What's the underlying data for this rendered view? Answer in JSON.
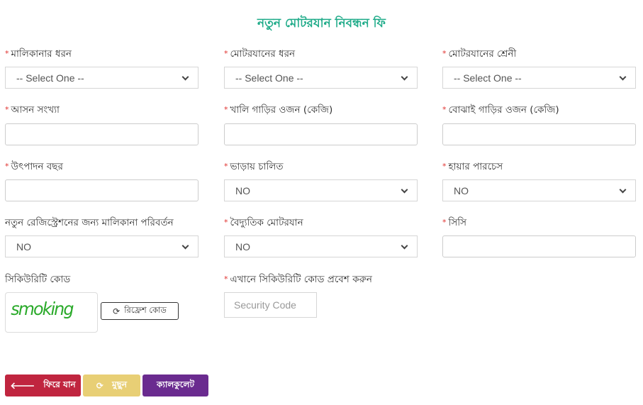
{
  "page": {
    "title": "নতুন মোটরযান নিবন্ধন ফি",
    "title_color": "#1fab89"
  },
  "fields": {
    "ownership_type": {
      "label": "মালিকানার ধরন",
      "required": true,
      "type": "select",
      "value": "-- Select One --"
    },
    "vehicle_type": {
      "label": "মোটরযানের ধরন",
      "required": true,
      "type": "select",
      "value": "-- Select One --"
    },
    "vehicle_class": {
      "label": "মোটরযানের শ্রেনী",
      "required": true,
      "type": "select",
      "value": "-- Select One --"
    },
    "seat_count": {
      "label": "আসন সংখ্যা",
      "required": true,
      "type": "text",
      "value": ""
    },
    "unladen_weight": {
      "label": "খালি গাড়ির ওজন (কেজি)",
      "required": true,
      "type": "text",
      "value": ""
    },
    "laden_weight": {
      "label": "বোঝাই গাড়ির ওজন (কেজি)",
      "required": true,
      "type": "text",
      "value": ""
    },
    "manufacture_year": {
      "label": "উৎপাদন বছর",
      "required": true,
      "type": "text",
      "value": ""
    },
    "hired": {
      "label": "ভাড়ায় চালিত",
      "required": true,
      "type": "select",
      "value": "NO"
    },
    "hire_purchase": {
      "label": "হায়ার পারচেস",
      "required": true,
      "type": "select",
      "value": "NO"
    },
    "ownership_transfer": {
      "label": "নতুন রেজিস্ট্রেশনের জন্য মালিকানা পরিবর্তন",
      "required": false,
      "type": "select",
      "value": "NO"
    },
    "electric_vehicle": {
      "label": "বৈদ্যুতিক মোটরযান",
      "required": true,
      "type": "select",
      "value": "NO"
    },
    "cc": {
      "label": "সিসি",
      "required": true,
      "type": "text",
      "value": ""
    }
  },
  "security": {
    "label": "সিকিউরিটি কোড",
    "captcha_text": "smoking",
    "refresh_label": "রিফ্রেশ কোড",
    "input_label": "এখানে সিকিউরিটি কোড প্রবেশ করুন",
    "input_placeholder": "Security Code",
    "input_value": ""
  },
  "buttons": {
    "back": {
      "label": "ফিরে যান",
      "icon": "arrow-left-icon",
      "color": "#c0253f"
    },
    "clear": {
      "label": "মুছুন",
      "icon": "refresh-icon",
      "color": "#e8cf75"
    },
    "calculate": {
      "label": "ক্যালকুলেট",
      "color": "#6a2b8f"
    }
  },
  "required_marker": "*",
  "icons": {
    "arrow_left": "🡐",
    "refresh": "⟳"
  }
}
